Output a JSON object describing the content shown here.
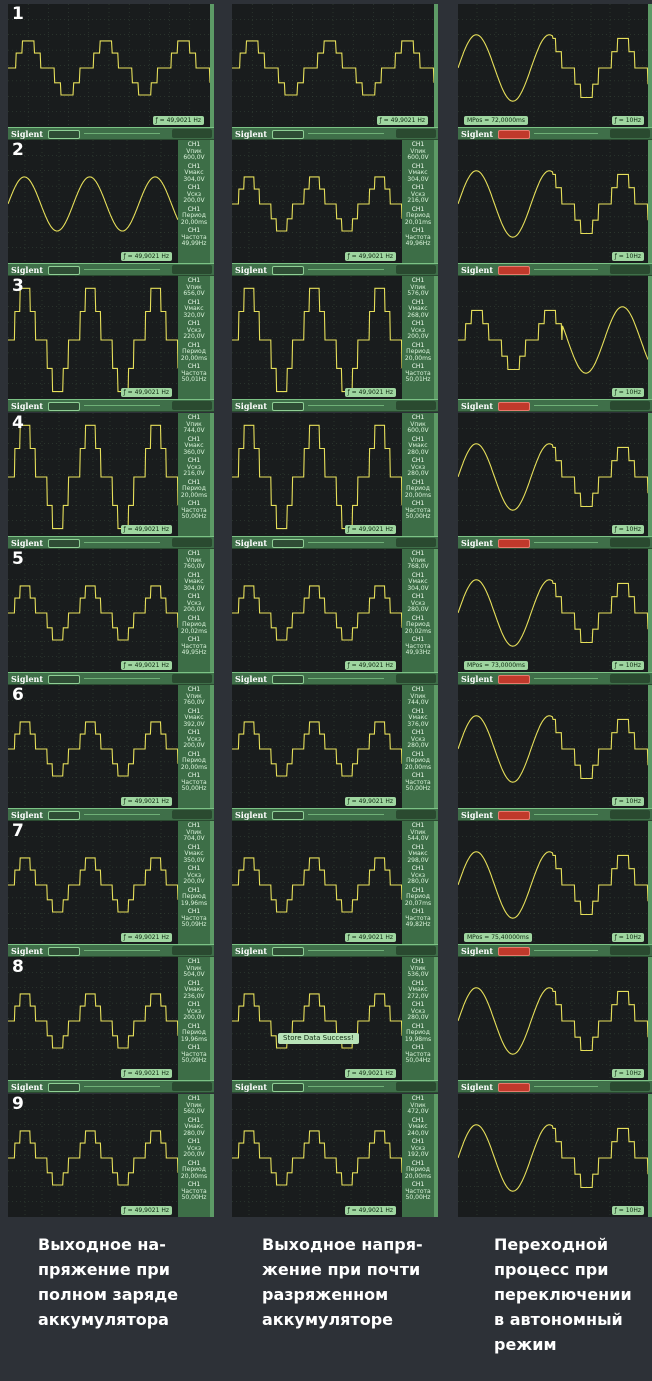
{
  "brand": "Siglent",
  "freq_label": "ƒ = 49,9021 Hz",
  "freq_label_short": "ƒ = 10Hz",
  "mpos_row1": "MPos = 72,0000ms",
  "mpos_row5": "MPos = 73,0000ms",
  "mpos_row7": "MPos = 75,40000ms",
  "store_toast": "Store Data Success!",
  "rows": [
    "1",
    "2",
    "3",
    "4",
    "5",
    "6",
    "7",
    "8",
    "9"
  ],
  "meas": {
    "ch": "CH1",
    "vpp_label": "Vпик",
    "vmax_label": "Vмакс",
    "vrms_label": "Vскз",
    "period_label": "Период",
    "freq_label": "Частота",
    "col1": [
      {
        "vpp": "600,0V",
        "vmax": "304,0V",
        "vrms": "200,0V",
        "period": "20,00ms",
        "freq": "49,99Hz"
      },
      {
        "vpp": "656,0V",
        "vmax": "320,0V",
        "vrms": "220,0V",
        "period": "20,00ms",
        "freq": "50,01Hz"
      },
      {
        "vpp": "744,0V",
        "vmax": "360,0V",
        "vrms": "216,0V",
        "period": "20,00ms",
        "freq": "50,00Hz"
      },
      {
        "vpp": "760,0V",
        "vmax": "304,0V",
        "vrms": "200,0V",
        "period": "20,02ms",
        "freq": "49,95Hz"
      },
      {
        "vpp": "760,0V",
        "vmax": "392,0V",
        "vrms": "200,0V",
        "period": "20,00ms",
        "freq": "50,00Hz"
      },
      {
        "vpp": "704,0V",
        "vmax": "350,0V",
        "vrms": "200,0V",
        "period": "19,96ms",
        "freq": "50,09Hz"
      },
      {
        "vpp": "504,0V",
        "vmax": "236,0V",
        "vrms": "200,0V",
        "period": "19,96ms",
        "freq": "50,09Hz"
      },
      {
        "vpp": "560,0V",
        "vmax": "280,0V",
        "vrms": "200,0V",
        "period": "20,00ms",
        "freq": "50,00Hz"
      }
    ],
    "col2": [
      {
        "vpp": "600,0V",
        "vmax": "304,0V",
        "vrms": "216,0V",
        "period": "20,01ms",
        "freq": "49,96Hz"
      },
      {
        "vpp": "576,0V",
        "vmax": "268,0V",
        "vrms": "200,0V",
        "period": "20,00ms",
        "freq": "50,01Hz"
      },
      {
        "vpp": "600,0V",
        "vmax": "280,0V",
        "vrms": "280,0V",
        "period": "20,00ms",
        "freq": "50,00Hz"
      },
      {
        "vpp": "768,0V",
        "vmax": "304,0V",
        "vrms": "280,0V",
        "period": "20,02ms",
        "freq": "49,93Hz"
      },
      {
        "vpp": "744,0V",
        "vmax": "376,0V",
        "vrms": "280,0V",
        "period": "20,00ms",
        "freq": "50,00Hz"
      },
      {
        "vpp": "544,0V",
        "vmax": "298,0V",
        "vrms": "280,0V",
        "period": "20,07ms",
        "freq": "49,82Hz"
      },
      {
        "vpp": "536,0V",
        "vmax": "272,0V",
        "vrms": "280,0V",
        "period": "19,98ms",
        "freq": "50,04Hz"
      },
      {
        "vpp": "472,0V",
        "vmax": "240,0V",
        "vrms": "192,0V",
        "period": "20,00ms",
        "freq": "50,00Hz"
      }
    ]
  },
  "captions": {
    "col1": [
      "Выходное на-",
      "пряжение при",
      "полном заряде",
      "аккумулятора"
    ],
    "col2": [
      "Выходное напря-",
      "жение при почти",
      "разряженном",
      "аккумуляторе"
    ],
    "col3": [
      "Переходной",
      "процесс при",
      "переключении",
      "в автономный",
      "режим"
    ]
  },
  "chart_data": {
    "type": "line",
    "title": "",
    "grid": true,
    "panels_layout": {
      "rows": 9,
      "columns": 3
    },
    "trace_color": "#e6df5a",
    "screen_color": "#191c1d",
    "frame_color": "#5d9a66",
    "columns": [
      {
        "name": "Выходное напряжение при полном заряде аккумулятора",
        "waveforms": [
          "stepped",
          "sine",
          "stepped",
          "stepped",
          "stepped",
          "stepped",
          "stepped",
          "stepped",
          "stepped"
        ]
      },
      {
        "name": "Выходное напряжение при почти разряженном аккумуляторе",
        "waveforms": [
          "stepped",
          "stepped",
          "stepped",
          "stepped",
          "stepped",
          "stepped",
          "stepped",
          "stepped",
          "stepped"
        ]
      },
      {
        "name": "Переходной процесс при переключении в автономный режим",
        "waveforms": [
          "sine-to-stepped",
          "sine-to-stepped",
          "stepped-to-sine",
          "sine-to-stepped",
          "sine-to-stepped",
          "sine-to-stepped",
          "sine-to-stepped",
          "sine-to-stepped",
          "sine-to-stepped"
        ]
      }
    ]
  }
}
